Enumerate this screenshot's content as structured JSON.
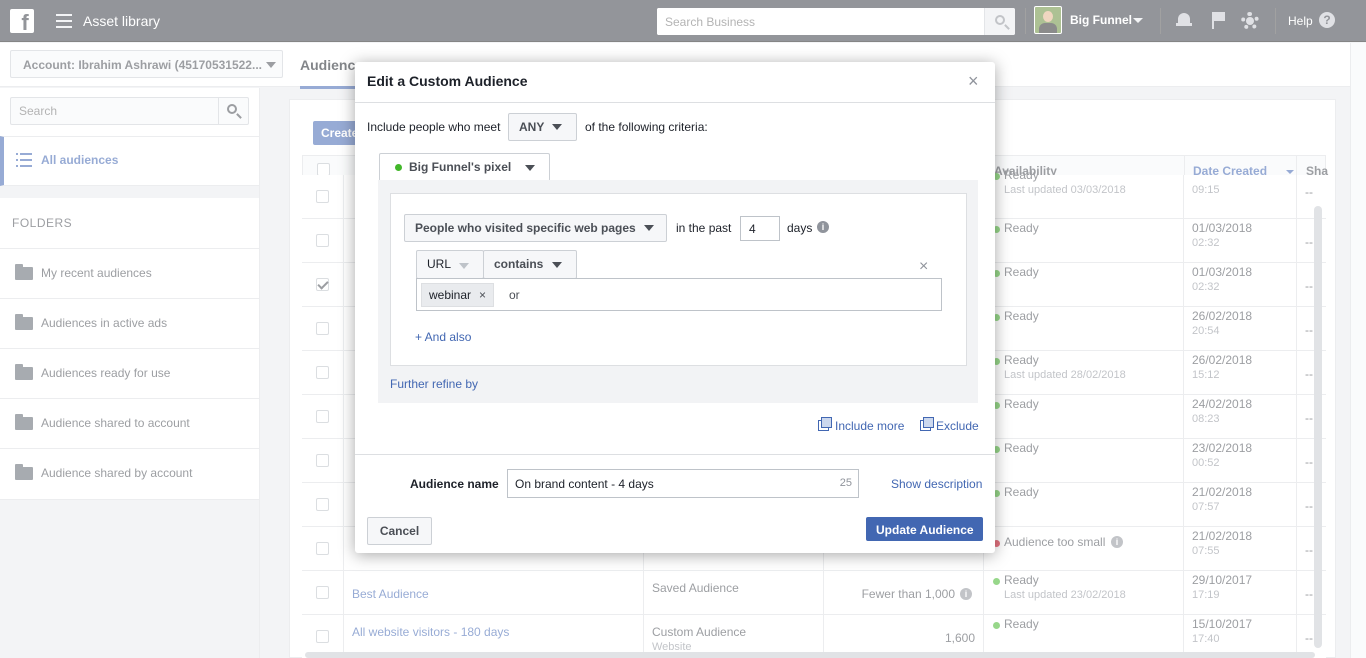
{
  "topbar": {
    "app_title": "Asset library",
    "search_placeholder": "Search Business",
    "account_name": "Big Funnel",
    "help_label": "Help"
  },
  "subbar": {
    "account_selector": "Account: Ibrahim Ashrawi (45170531522...",
    "active_tab": "Audiences"
  },
  "sidebar": {
    "search_placeholder": "Search",
    "all_audiences": "All audiences",
    "folders_title": "FOLDERS",
    "folders": [
      "My recent audiences",
      "Audiences in active ads",
      "Audiences ready for use",
      "Audience shared to account",
      "Audience shared by account"
    ]
  },
  "main": {
    "create_button": "Create",
    "columns": {
      "availability": "Availability",
      "date_created": "Date Created",
      "shared": "Sha"
    },
    "rows": [
      {
        "name": "",
        "type": "",
        "subtype": "",
        "size": "",
        "status": "Ready",
        "status_note": "Last updated 03/03/2018",
        "date": "",
        "time": "09:15",
        "shared": "--"
      },
      {
        "name": "",
        "type": "",
        "subtype": "",
        "size": "",
        "status": "Ready",
        "status_note": "",
        "date": "01/03/2018",
        "time": "02:32",
        "shared": "--"
      },
      {
        "name": "",
        "type": "",
        "subtype": "",
        "size": "",
        "status": "Ready",
        "status_note": "",
        "date": "01/03/2018",
        "time": "02:32",
        "shared": "--"
      },
      {
        "name": "",
        "type": "",
        "subtype": "",
        "size": "",
        "status": "Ready",
        "status_note": "",
        "date": "26/02/2018",
        "time": "20:54",
        "shared": "--"
      },
      {
        "name": "",
        "type": "",
        "subtype": "",
        "size": "",
        "status": "Ready",
        "status_note": "Last updated 28/02/2018",
        "date": "26/02/2018",
        "time": "15:12",
        "shared": "--"
      },
      {
        "name": "",
        "type": "",
        "subtype": "",
        "size": "",
        "status": "Ready",
        "status_note": "",
        "date": "24/02/2018",
        "time": "08:23",
        "shared": "--"
      },
      {
        "name": "",
        "type": "",
        "subtype": "",
        "size": "",
        "status": "Ready",
        "status_note": "",
        "date": "23/02/2018",
        "time": "00:52",
        "shared": "--"
      },
      {
        "name": "",
        "type": "",
        "subtype": "",
        "size": "",
        "status": "Ready",
        "status_note": "",
        "date": "21/02/2018",
        "time": "07:57",
        "shared": "--"
      },
      {
        "name": "",
        "type": "",
        "subtype": "",
        "size": "",
        "status": "Audience too small",
        "status_note": "",
        "date": "21/02/2018",
        "time": "07:55",
        "shared": "--"
      },
      {
        "name": "Best Audience",
        "type": "Saved Audience",
        "subtype": "",
        "size": "Fewer than 1,000",
        "status": "Ready",
        "status_note": "Last updated 23/02/2018",
        "date": "29/10/2017",
        "time": "17:19",
        "shared": "--"
      },
      {
        "name": "All website visitors - 180 days",
        "type": "Custom Audience",
        "subtype": "Website",
        "size": "1,600",
        "status": "Ready",
        "status_note": "",
        "date": "15/10/2017",
        "time": "17:40",
        "shared": "--"
      }
    ]
  },
  "modal": {
    "title": "Edit a Custom Audience",
    "close_glyph": "×",
    "include_prefix": "Include people who meet",
    "match_value": "ANY",
    "include_suffix": "of the following criteria:",
    "pixel_name": "Big Funnel's pixel",
    "rule_type": "People who visited specific web pages",
    "in_the_past": "in the past",
    "days_value": "4",
    "days_label": "days",
    "url_field": "URL",
    "operator": "contains",
    "remove_glyph": "×",
    "tag_value": "webinar",
    "tag_remove": "×",
    "or_label": "or",
    "and_also": "+ And also",
    "further_refine": "Further refine by",
    "include_more": "Include more",
    "exclude": "Exclude",
    "audience_name_label": "Audience name",
    "audience_name_value": "On brand content - 4 days",
    "char_count": "25",
    "show_description": "Show description",
    "cancel": "Cancel",
    "update": "Update Audience"
  },
  "colors": {
    "topbar": "#3b3f48",
    "accent": "#4267b2",
    "ready": "#42b72a",
    "warning": "#d0021b"
  }
}
